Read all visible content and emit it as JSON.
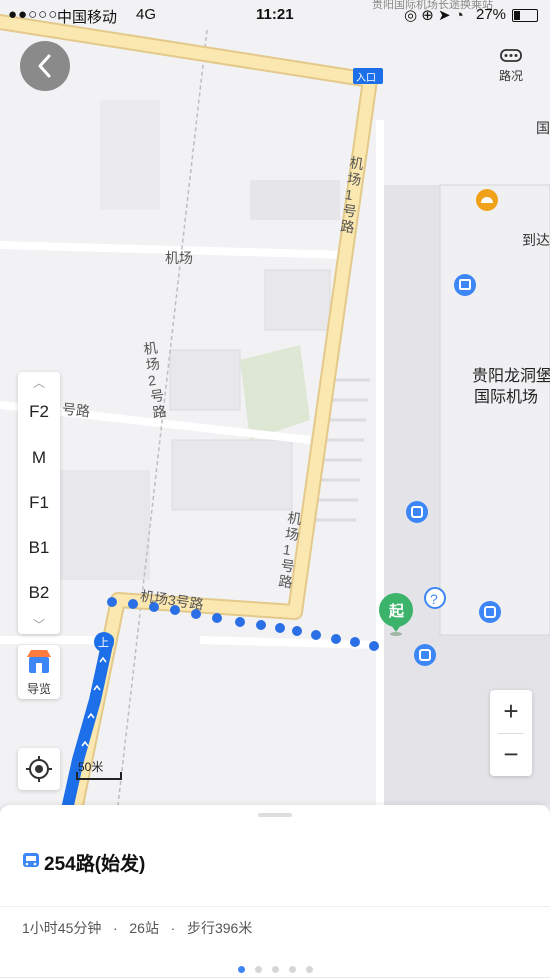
{
  "status_bar": {
    "carrier": "中国移动",
    "network": "4G",
    "time": "11:21",
    "battery": "27%"
  },
  "map": {
    "traffic_label": "路况",
    "entrance_label": "入口",
    "labels": {
      "airport": "机场",
      "road1_top": "机场1号路",
      "road1_bottom": "机场1号路",
      "road2": "机场2号路",
      "road3": "机场3号路",
      "road_left": "号路",
      "terminal_line1": "贵阳龙洞堡",
      "terminal_line2": "国际机场",
      "arrival": "到达",
      "top_building": "贵阳国际机场长途换乘站",
      "edge_char": "国"
    },
    "start_marker": "起",
    "board_marker": "上",
    "scale_label": "50米"
  },
  "floor_panel": {
    "floors": [
      "F2",
      "M",
      "F1",
      "B1",
      "B2"
    ]
  },
  "guide": {
    "label": "导览"
  },
  "zoom": {
    "in": "+",
    "out": "−"
  },
  "route": {
    "title": "254路(始发)",
    "duration": "1小时45分钟",
    "stops": "26站",
    "walk": "步行396米",
    "separator": "·"
  },
  "pager": {
    "count": 5,
    "active": 1
  },
  "colors": {
    "road_fill": "#fbe7b0",
    "road_edge": "#e3c98a",
    "route_blue": "#1c6fe8",
    "walk_dots": "#2a6fe6",
    "start_green": "#3bb36b",
    "accent": "#3d86f5"
  }
}
